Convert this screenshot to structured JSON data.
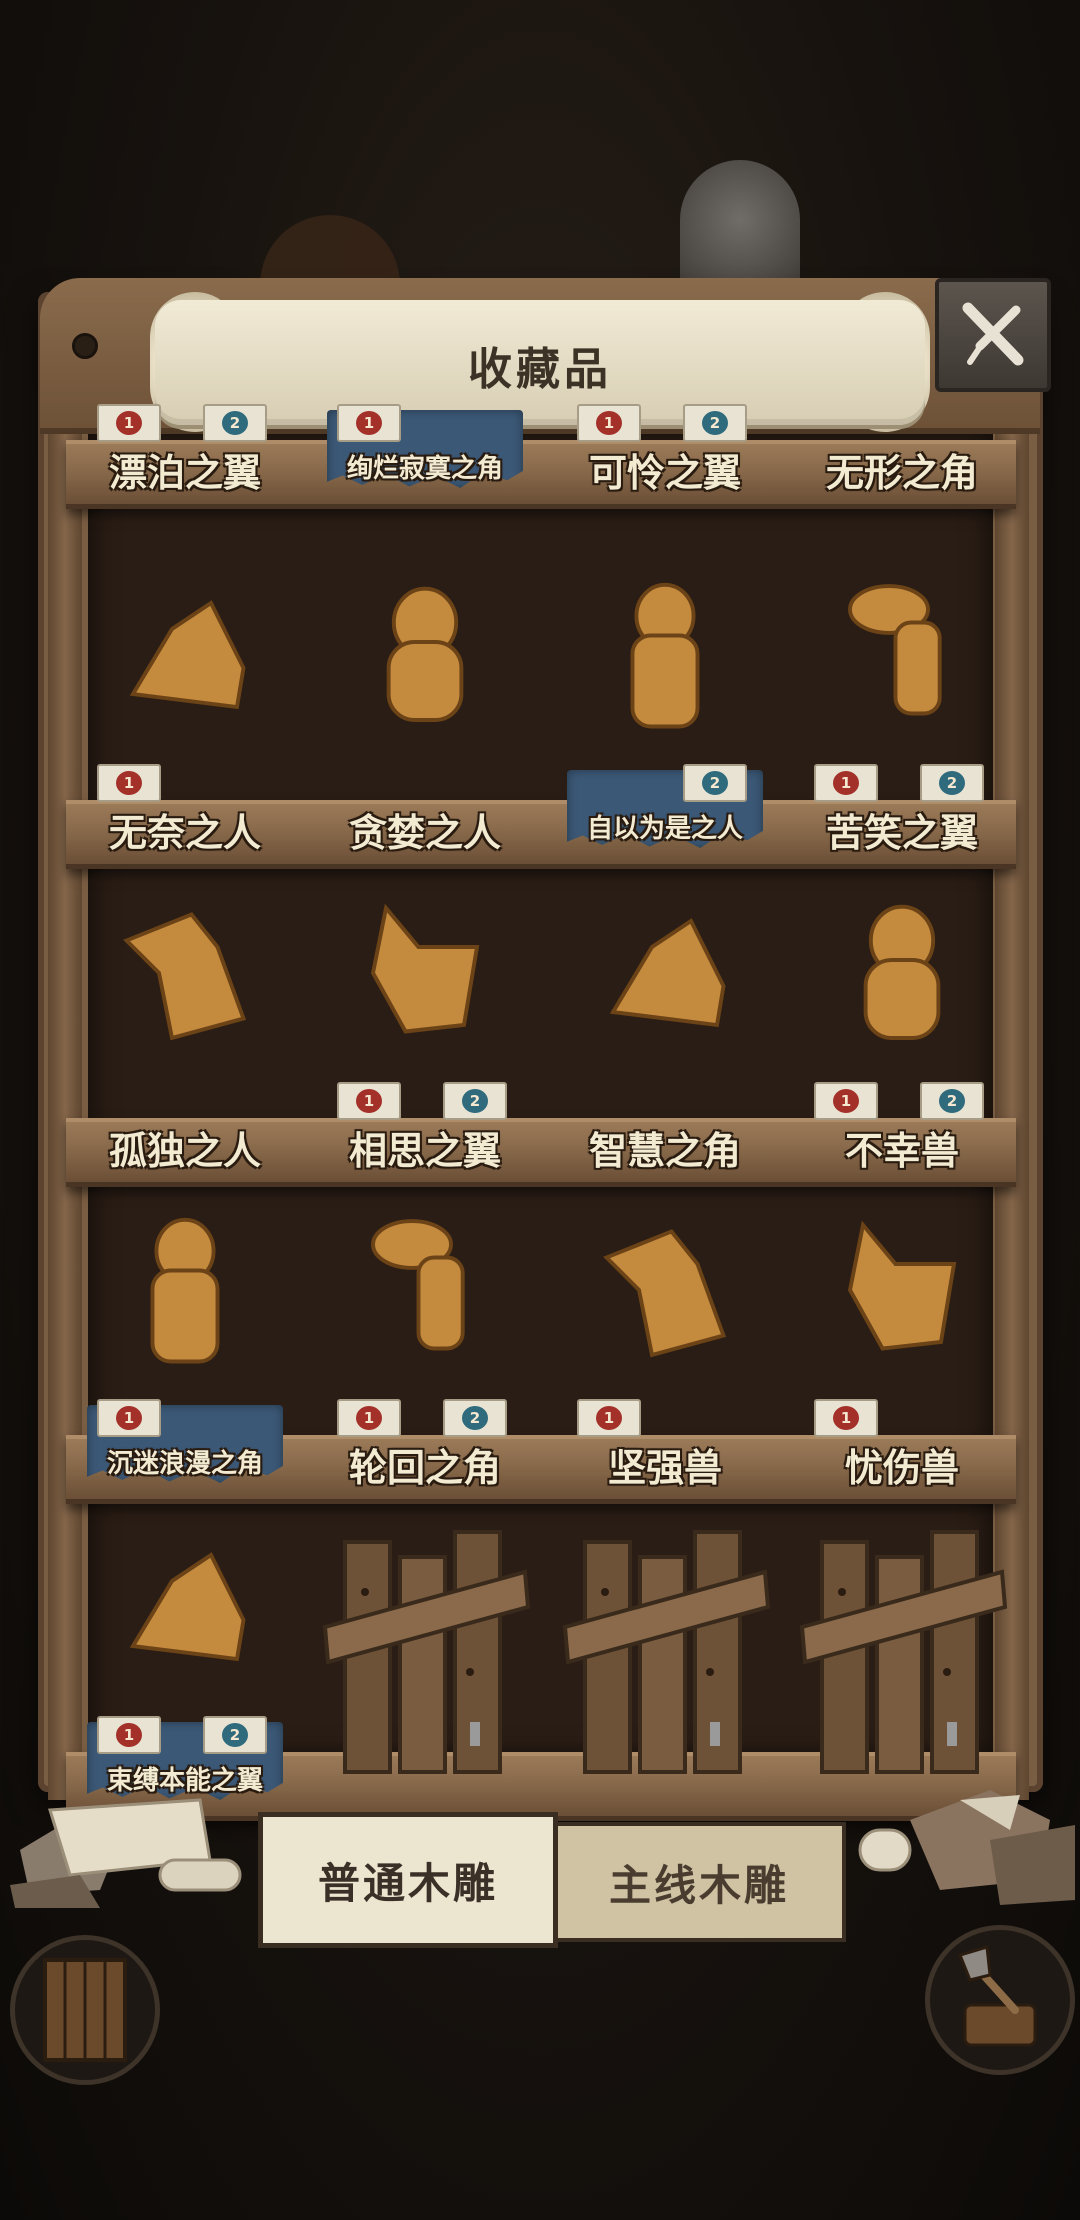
{
  "title": "收藏品",
  "shelves": [
    {
      "items": [
        {
          "name": "漂泊之翼",
          "stamps": [
            "1",
            "2"
          ],
          "banner": false,
          "locked": false
        },
        {
          "name": "绚烂寂寞之角",
          "stamps": [
            "1"
          ],
          "banner": true,
          "locked": false
        },
        {
          "name": "可怜之翼",
          "stamps": [
            "1",
            "2"
          ],
          "banner": false,
          "locked": false
        },
        {
          "name": "无形之角",
          "stamps": [],
          "banner": false,
          "locked": false
        }
      ]
    },
    {
      "items": [
        {
          "name": "无奈之人",
          "stamps": [
            "1"
          ],
          "banner": false,
          "locked": false
        },
        {
          "name": "贪婪之人",
          "stamps": [],
          "banner": false,
          "locked": false
        },
        {
          "name": "自以为是之人",
          "stamps": [
            "2"
          ],
          "banner": true,
          "locked": false
        },
        {
          "name": "苦笑之翼",
          "stamps": [
            "1",
            "2"
          ],
          "banner": false,
          "locked": false
        }
      ]
    },
    {
      "items": [
        {
          "name": "孤独之人",
          "stamps": [],
          "banner": false,
          "locked": false
        },
        {
          "name": "相思之翼",
          "stamps": [
            "1",
            "2"
          ],
          "banner": false,
          "locked": false
        },
        {
          "name": "智慧之角",
          "stamps": [],
          "banner": false,
          "locked": false
        },
        {
          "name": "不幸兽",
          "stamps": [
            "1",
            "2"
          ],
          "banner": false,
          "locked": false
        }
      ]
    },
    {
      "items": [
        {
          "name": "沉迷浪漫之角",
          "stamps": [
            "1"
          ],
          "banner": true,
          "locked": false
        },
        {
          "name": "轮回之角",
          "stamps": [
            "1",
            "2"
          ],
          "banner": false,
          "locked": false
        },
        {
          "name": "坚强兽",
          "stamps": [
            "1"
          ],
          "banner": false,
          "locked": false
        },
        {
          "name": "忧伤兽",
          "stamps": [
            "1"
          ],
          "banner": false,
          "locked": false
        }
      ]
    },
    {
      "items": [
        {
          "name": "束缚本能之翼",
          "stamps": [
            "1",
            "2"
          ],
          "banner": true,
          "locked": false
        },
        {
          "name": "",
          "stamps": [],
          "banner": false,
          "locked": true
        },
        {
          "name": "",
          "stamps": [],
          "banner": false,
          "locked": true
        },
        {
          "name": "",
          "stamps": [],
          "banner": false,
          "locked": true
        }
      ]
    }
  ],
  "tabs": [
    {
      "label": "普通木雕",
      "active": true
    },
    {
      "label": "主线木雕",
      "active": false
    }
  ],
  "icons": {
    "close": "close-x-icon",
    "left_corner": "wooden-door-icon",
    "right_corner": "axe-stump-icon"
  },
  "colors": {
    "wood": "#7a5e43",
    "cloth_banner": "#3b5876",
    "carving": "#c48a3e",
    "seal_red": "#a3312a",
    "seal_teal": "#2f6b7c"
  }
}
